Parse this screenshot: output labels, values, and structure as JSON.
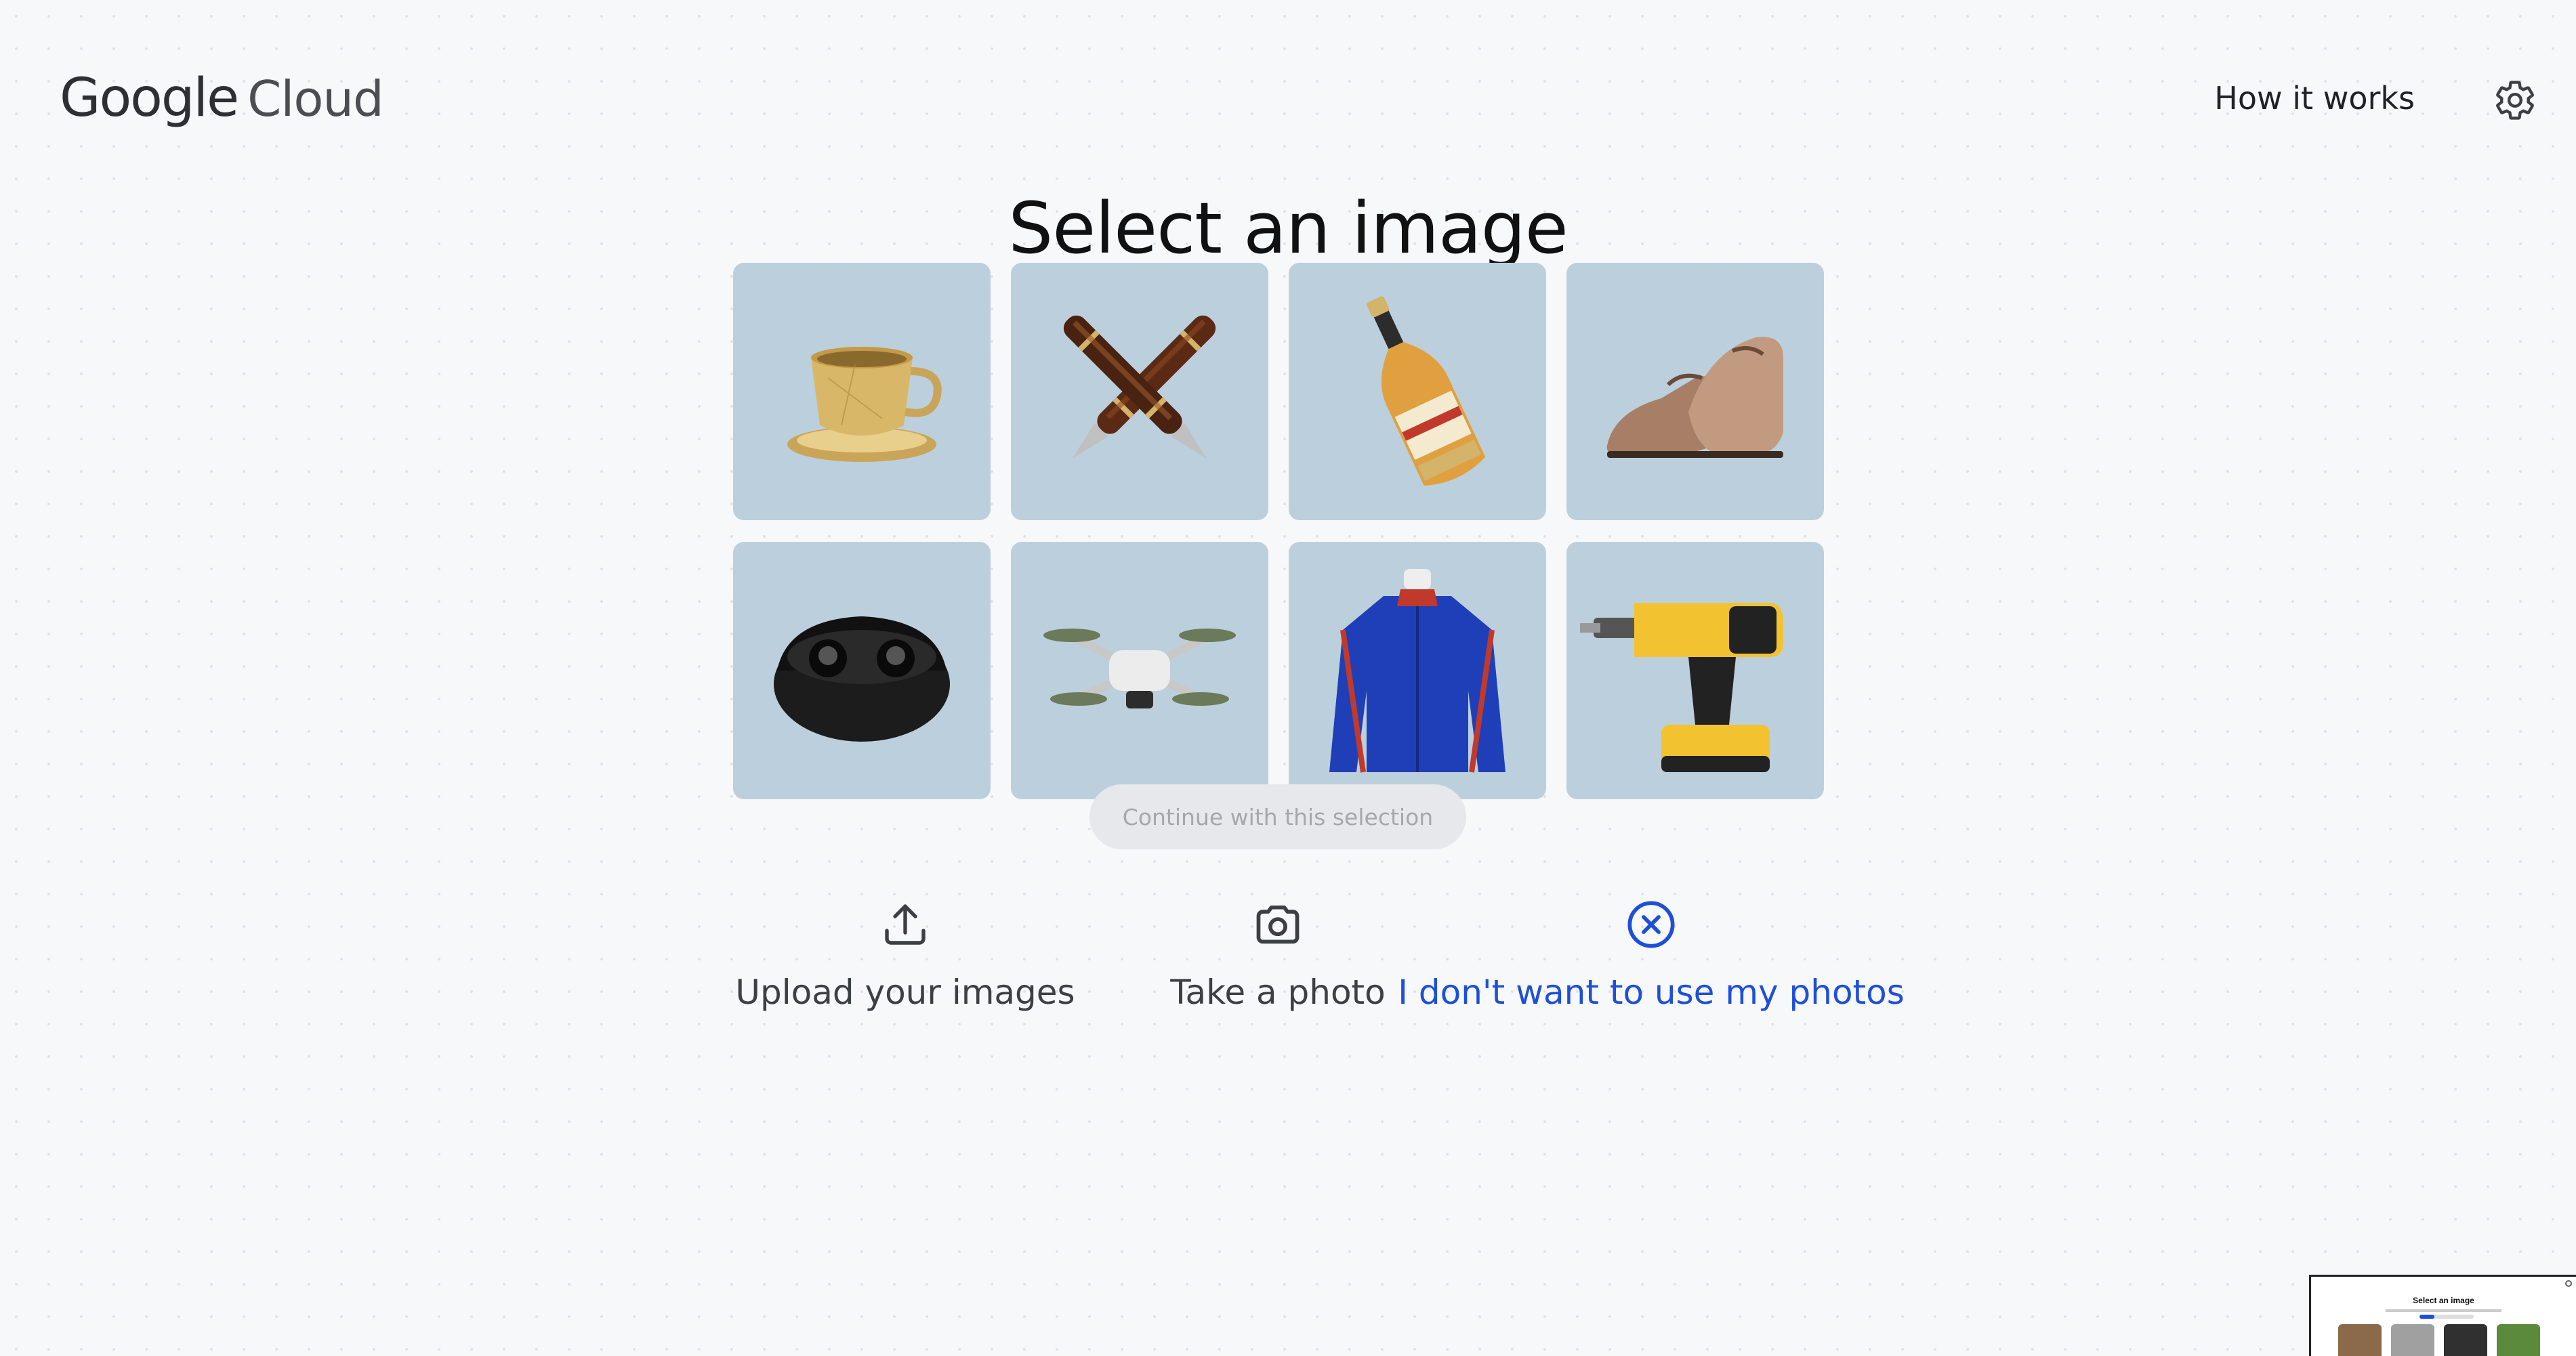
{
  "header": {
    "brand": "Google",
    "product": "Cloud",
    "how_it_works": "How it works",
    "settings_icon": "gear-icon"
  },
  "main": {
    "title": "Select an image",
    "subtitle": "",
    "images": [
      {
        "name": "teacup-image",
        "subject": "gold teacup and saucer"
      },
      {
        "name": "fountain-pens-image",
        "subject": "crossed fountain pens"
      },
      {
        "name": "bottle-image",
        "subject": "champagne bottle"
      },
      {
        "name": "shoes-image",
        "subject": "leather dress shoes"
      },
      {
        "name": "earbuds-image",
        "subject": "wireless earbuds case"
      },
      {
        "name": "drone-image",
        "subject": "quadcopter drone"
      },
      {
        "name": "jacket-image",
        "subject": "blue track jacket"
      },
      {
        "name": "drill-image",
        "subject": "yellow cordless drill"
      }
    ],
    "continue_label": "Continue with this selection"
  },
  "actions": {
    "upload_label": "Upload your images",
    "upload_icon": "upload-icon",
    "photo_label": "Take a photo",
    "photo_icon": "camera-icon",
    "no_photos_label": "I don't want to use my photos",
    "no_photos_icon": "close-circle-icon"
  },
  "preview": {
    "title": "Select an image"
  },
  "colors": {
    "background": "#f6f8fa",
    "tile": "#bccfdc",
    "accent_blue": "#1f4fd8",
    "disabled_button": "#e6e8eb"
  }
}
